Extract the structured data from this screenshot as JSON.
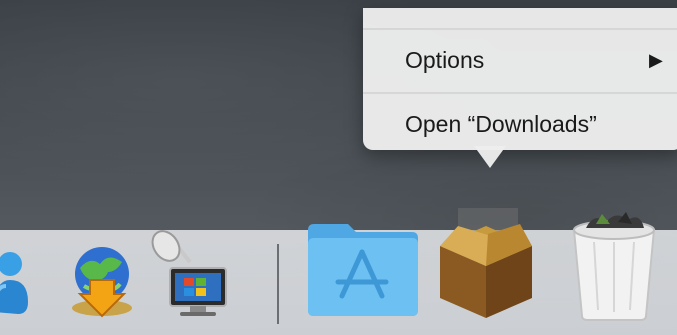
{
  "context_menu": {
    "items": [
      {
        "label": "Options",
        "submenu_arrow": "▶"
      },
      {
        "label": "Open “Downloads”"
      }
    ]
  },
  "dock": {
    "items": [
      {
        "name": "person-app-icon"
      },
      {
        "name": "download-globe-icon"
      },
      {
        "name": "remote-desktop-icon"
      },
      {
        "name": "applications-folder-icon"
      },
      {
        "name": "downloads-box-icon"
      },
      {
        "name": "trash-icon"
      }
    ]
  },
  "colors": {
    "menu_bg": "#eeeeee",
    "folder_blue": "#62b8ef",
    "box_brown": "#8a5a22"
  }
}
